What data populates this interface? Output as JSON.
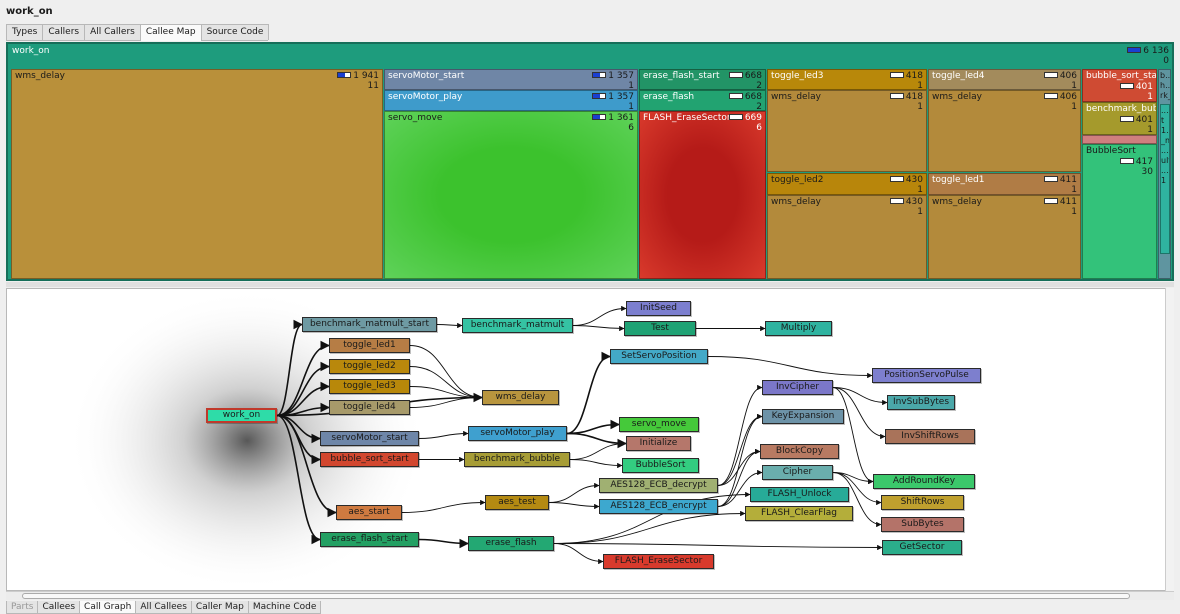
{
  "title": "work_on",
  "top_tabs": [
    "Types",
    "Callers",
    "All Callers",
    "Callee Map",
    "Source Code"
  ],
  "top_tab_active": "Callee Map",
  "treemap": {
    "root": {
      "label": "work_on",
      "value": "6 136",
      "sub": "0",
      "color": "#1ec79a"
    },
    "cells": [
      {
        "label": "wms_delay",
        "value": "1 941",
        "sub": "11",
        "color": "#b9903a"
      },
      {
        "label": "servoMotor_start",
        "value": "1 357",
        "sub": "1",
        "color": "#6f86a6"
      },
      {
        "label": "servoMotor_play",
        "value": "1 357",
        "sub": "1",
        "color": "#3e9bcb"
      },
      {
        "label": "servo_move",
        "value": "1 361",
        "sub": "6",
        "color": "#3ec334"
      },
      {
        "label": "erase_flash_start",
        "value": "668",
        "sub": "2",
        "color": "#229466"
      },
      {
        "label": "erase_flash",
        "value": "668",
        "sub": "2",
        "color": "#22a371"
      },
      {
        "label": "FLASH_EraseSector",
        "value": "669",
        "sub": "6",
        "color": "#c7281f"
      },
      {
        "label": "toggle_led3",
        "value": "418",
        "sub": "1",
        "color": "#b8880a"
      },
      {
        "label": "wms_delay",
        "value": "418",
        "sub": "1",
        "color": "#b38a3b"
      },
      {
        "label": "toggle_led4",
        "value": "406",
        "sub": "1",
        "color": "#a38b5c"
      },
      {
        "label": "wms_delay",
        "value": "406",
        "sub": "1",
        "color": "#b38a3b"
      },
      {
        "label": "toggle_led2",
        "value": "430",
        "sub": "1",
        "color": "#b8860b"
      },
      {
        "label": "wms_delay",
        "value": "430",
        "sub": "1",
        "color": "#b38a3b"
      },
      {
        "label": "toggle_led1",
        "value": "411",
        "sub": "1",
        "color": "#b07c45"
      },
      {
        "label": "wms_delay",
        "value": "411",
        "sub": "1",
        "color": "#b38a3b"
      },
      {
        "label": "bubble_sort_start",
        "value": "401",
        "sub": "1",
        "color": "#cf4b33"
      },
      {
        "label": "benchmark_bubble",
        "value": "401",
        "sub": "1",
        "color": "#a59a2c"
      },
      {
        "label": "BubbleSort",
        "value": "417",
        "sub": "30",
        "color": "#33c27a"
      },
      {
        "label": "b... h... rk_",
        "value": "",
        "sub": "",
        "color": "#5f95a0"
      },
      {
        "label": "... t 1... _m ... ult ... 1",
        "value": "",
        "sub": "",
        "color": "#2fb3a0"
      }
    ]
  },
  "call_graph": {
    "nodes": [
      {
        "id": "work_on",
        "label": "work_on",
        "color": "#2edca8"
      },
      {
        "id": "benchmark_matmult_start",
        "label": "benchmark_matmult_start",
        "color": "#6e9aa3"
      },
      {
        "id": "benchmark_matmult",
        "label": "benchmark_matmult",
        "color": "#35c3a3"
      },
      {
        "id": "InitSeed",
        "label": "InitSeed",
        "color": "#7c7fcf"
      },
      {
        "id": "Test",
        "label": "Test",
        "color": "#1fa274"
      },
      {
        "id": "Multiply",
        "label": "Multiply",
        "color": "#2fb3a0"
      },
      {
        "id": "toggle_led1",
        "label": "toggle_led1",
        "color": "#b67d45"
      },
      {
        "id": "toggle_led2",
        "label": "toggle_led2",
        "color": "#b9880c"
      },
      {
        "id": "toggle_led3",
        "label": "toggle_led3",
        "color": "#b8880a"
      },
      {
        "id": "toggle_led4",
        "label": "toggle_led4",
        "color": "#a79a6a"
      },
      {
        "id": "wms_delay",
        "label": "wms_delay",
        "color": "#b8953e"
      },
      {
        "id": "SetServoPosition",
        "label": "SetServoPosition",
        "color": "#43a9c7"
      },
      {
        "id": "PositionServoPulse",
        "label": "PositionServoPulse",
        "color": "#7d7fce"
      },
      {
        "id": "InvCipher",
        "label": "InvCipher",
        "color": "#7b77c9"
      },
      {
        "id": "InvSubBytes",
        "label": "InvSubBytes",
        "color": "#4aa7a9"
      },
      {
        "id": "KeyExpansion",
        "label": "KeyExpansion",
        "color": "#6d93a8"
      },
      {
        "id": "InvShiftRows",
        "label": "InvShiftRows",
        "color": "#a9735a"
      },
      {
        "id": "servoMotor_start",
        "label": "servoMotor_start",
        "color": "#6e86a8"
      },
      {
        "id": "servoMotor_play",
        "label": "servoMotor_play",
        "color": "#3fa0cf"
      },
      {
        "id": "servo_move",
        "label": "servo_move",
        "color": "#45c93a"
      },
      {
        "id": "Initialize",
        "label": "Initialize",
        "color": "#b5776b"
      },
      {
        "id": "BlockCopy",
        "label": "BlockCopy",
        "color": "#b87a62"
      },
      {
        "id": "bubble_sort_start",
        "label": "bubble_sort_start",
        "color": "#d2472f"
      },
      {
        "id": "benchmark_bubble",
        "label": "benchmark_bubble",
        "color": "#a79d36"
      },
      {
        "id": "BubbleSort",
        "label": "BubbleSort",
        "color": "#33cd80"
      },
      {
        "id": "Cipher",
        "label": "Cipher",
        "color": "#6aaead"
      },
      {
        "id": "AddRoundKey",
        "label": "AddRoundKey",
        "color": "#3bc86b"
      },
      {
        "id": "AES128_ECB_decrypt",
        "label": "AES128_ECB_decrypt",
        "color": "#a0b072"
      },
      {
        "id": "aes_test",
        "label": "aes_test",
        "color": "#b48a12"
      },
      {
        "id": "AES128_ECB_encrypt",
        "label": "AES128_ECB_encrypt",
        "color": "#3da8cf"
      },
      {
        "id": "FLASH_Unlock",
        "label": "FLASH_Unlock",
        "color": "#27ab98"
      },
      {
        "id": "ShiftRows",
        "label": "ShiftRows",
        "color": "#bfa02e"
      },
      {
        "id": "aes_start",
        "label": "aes_start",
        "color": "#cf7a40"
      },
      {
        "id": "FLASH_ClearFlag",
        "label": "FLASH_ClearFlag",
        "color": "#b4ae3a"
      },
      {
        "id": "SubBytes",
        "label": "SubBytes",
        "color": "#b47369"
      },
      {
        "id": "erase_flash_start",
        "label": "erase_flash_start",
        "color": "#23a063"
      },
      {
        "id": "erase_flash",
        "label": "erase_flash",
        "color": "#23a873"
      },
      {
        "id": "GetSector",
        "label": "GetSector",
        "color": "#2bae8b"
      },
      {
        "id": "FLASH_EraseSector",
        "label": "FLASH_EraseSector",
        "color": "#d83a2c"
      }
    ],
    "edges": [
      [
        "work_on",
        "benchmark_matmult_start"
      ],
      [
        "work_on",
        "toggle_led1"
      ],
      [
        "work_on",
        "toggle_led2"
      ],
      [
        "work_on",
        "toggle_led3"
      ],
      [
        "work_on",
        "toggle_led4"
      ],
      [
        "work_on",
        "wms_delay"
      ],
      [
        "work_on",
        "servoMotor_start"
      ],
      [
        "work_on",
        "bubble_sort_start"
      ],
      [
        "work_on",
        "aes_start"
      ],
      [
        "work_on",
        "erase_flash_start"
      ],
      [
        "benchmark_matmult_start",
        "benchmark_matmult"
      ],
      [
        "benchmark_matmult",
        "InitSeed"
      ],
      [
        "benchmark_matmult",
        "Test"
      ],
      [
        "Test",
        "Multiply"
      ],
      [
        "toggle_led1",
        "wms_delay"
      ],
      [
        "toggle_led2",
        "wms_delay"
      ],
      [
        "toggle_led3",
        "wms_delay"
      ],
      [
        "toggle_led4",
        "wms_delay"
      ],
      [
        "servoMotor_start",
        "servoMotor_play"
      ],
      [
        "servoMotor_play",
        "servo_move"
      ],
      [
        "servoMotor_play",
        "SetServoPosition"
      ],
      [
        "servoMotor_play",
        "Initialize"
      ],
      [
        "SetServoPosition",
        "PositionServoPulse"
      ],
      [
        "bubble_sort_start",
        "benchmark_bubble"
      ],
      [
        "benchmark_bubble",
        "BubbleSort"
      ],
      [
        "benchmark_bubble",
        "Initialize"
      ],
      [
        "aes_start",
        "aes_test"
      ],
      [
        "aes_test",
        "AES128_ECB_decrypt"
      ],
      [
        "aes_test",
        "AES128_ECB_encrypt"
      ],
      [
        "AES128_ECB_decrypt",
        "InvCipher"
      ],
      [
        "AES128_ECB_decrypt",
        "KeyExpansion"
      ],
      [
        "AES128_ECB_decrypt",
        "BlockCopy"
      ],
      [
        "AES128_ECB_encrypt",
        "Cipher"
      ],
      [
        "AES128_ECB_encrypt",
        "KeyExpansion"
      ],
      [
        "AES128_ECB_encrypt",
        "BlockCopy"
      ],
      [
        "InvCipher",
        "InvSubBytes"
      ],
      [
        "InvCipher",
        "InvShiftRows"
      ],
      [
        "InvCipher",
        "AddRoundKey"
      ],
      [
        "Cipher",
        "AddRoundKey"
      ],
      [
        "Cipher",
        "ShiftRows"
      ],
      [
        "Cipher",
        "SubBytes"
      ],
      [
        "erase_flash_start",
        "erase_flash"
      ],
      [
        "erase_flash",
        "FLASH_Unlock"
      ],
      [
        "erase_flash",
        "FLASH_ClearFlag"
      ],
      [
        "erase_flash",
        "GetSector"
      ],
      [
        "erase_flash",
        "FLASH_EraseSector"
      ]
    ]
  },
  "bottom_tabs": [
    "Parts",
    "Callees",
    "Call Graph",
    "All Callees",
    "Caller Map",
    "Machine Code"
  ],
  "bottom_tab_active": "Call Graph",
  "bottom_tab_disabled": "Parts"
}
